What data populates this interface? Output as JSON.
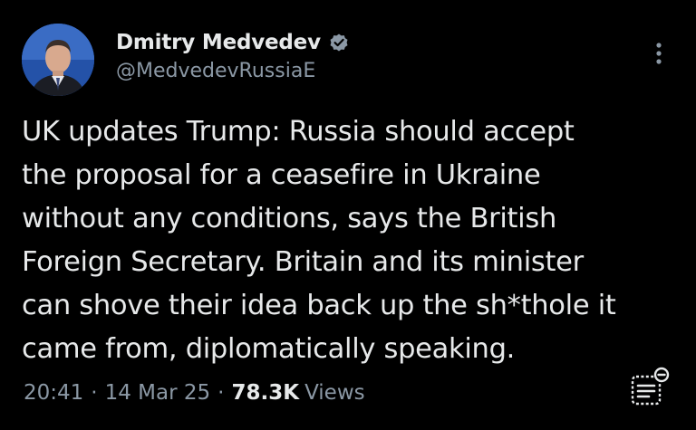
{
  "author": {
    "display_name": "Dmitry Medvedev",
    "handle": "@MedvedevRussiaE",
    "verified": true
  },
  "tweet": {
    "text": "UK updates Trump: Russia should accept\nthe proposal for a ceasefire in Ukraine\nwithout any conditions, says the British\nForeign Secretary. Britain and its minister\ncan shove their idea back up the sh*thole it\ncame from, diplomatically speaking.",
    "time": "20:41",
    "date": "14 Mar 25",
    "separator": "·",
    "views_count": "78.3K",
    "views_label": "Views"
  },
  "icons": {
    "verified": "verified-badge-icon",
    "more": "more-vertical-icon",
    "analytics": "analytics-icon"
  },
  "colors": {
    "background": "#000000",
    "primary_text": "#e7e9ea",
    "secondary_text": "#8b98a5",
    "verified_badge": "#8b98a5"
  }
}
